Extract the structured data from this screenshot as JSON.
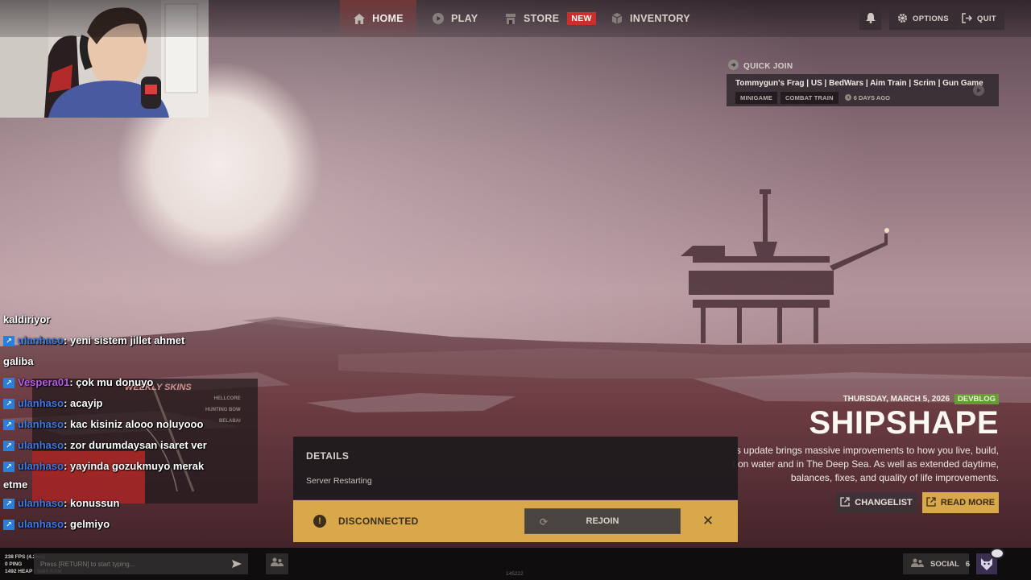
{
  "nav": {
    "items": [
      {
        "label": "HOME",
        "icon": "home-icon"
      },
      {
        "label": "PLAY",
        "icon": "play-icon"
      },
      {
        "label": "STORE",
        "icon": "store-icon",
        "badge": "NEW"
      },
      {
        "label": "INVENTORY",
        "icon": "box-icon"
      }
    ],
    "options_label": "OPTIONS",
    "quit_label": "QUIT"
  },
  "quick_join": {
    "title": "QUICK JOIN",
    "server_name": "Tommygun's Frag | US | BedWars | Aim Train | Scrim | Gun Game",
    "tags": [
      "MINIGAME",
      "COMBAT TRAIN"
    ],
    "age": "6 DAYS AGO"
  },
  "chat": {
    "lines": [
      {
        "user": "",
        "message": "kaldiriyor"
      },
      {
        "user": "ulanhaso",
        "message": " : yeni sistem jillet ahmet"
      },
      {
        "user": "",
        "message": "galiba"
      },
      {
        "user": "Vespera01",
        "message": " : çok mu donuyo"
      },
      {
        "user": "ulanhaso",
        "message": " : acayip"
      },
      {
        "user": "ulanhaso",
        "message": " : kac kisiniz alooo noluyooo"
      },
      {
        "user": "ulanhaso",
        "message": " : zor durumdaysan isaret ver"
      },
      {
        "user": "ulanhaso",
        "message": " : yayinda gozukmuyo merak"
      },
      {
        "user": "",
        "message": "etme"
      },
      {
        "user": "ulanhaso",
        "message": " : konussun"
      },
      {
        "user": "ulanhaso",
        "message": " : gelmiyo"
      }
    ],
    "weekly_label": "WEEKLY SKINS",
    "weekly_items": [
      "HELLCORE",
      "HUNTING BOW",
      "BELABAI"
    ]
  },
  "news": {
    "date": "THURSDAY, MARCH 5, 2026",
    "tag": "DEVBLOG",
    "title": "SHIPSHAPE",
    "desc_line1": "s update brings massive improvements to how you live, build,",
    "desc_line2": "t on water and in The Deep Sea. As well as extended daytime,",
    "desc_line3": "balances, fixes, and quality of life improvements.",
    "changelist_label": "CHANGELIST",
    "readmore_label": "READ MORE",
    "tag_color": "#6a9a36",
    "accent_color": "#d8a84b"
  },
  "details": {
    "title": "DETAILS",
    "status": "Server Restarting"
  },
  "disconnect": {
    "label": "DISCONNECTED",
    "rejoin_label": "REJOIN"
  },
  "bottom": {
    "fps": "238 FPS (4.2ms)",
    "ping": "0 PING",
    "memory": "1492 HEAP / 5066 RAM",
    "chat_placeholder": "Press [RETURN] to start typing...",
    "version": "145222",
    "social_label": "SOCIAL",
    "social_count": "6"
  }
}
